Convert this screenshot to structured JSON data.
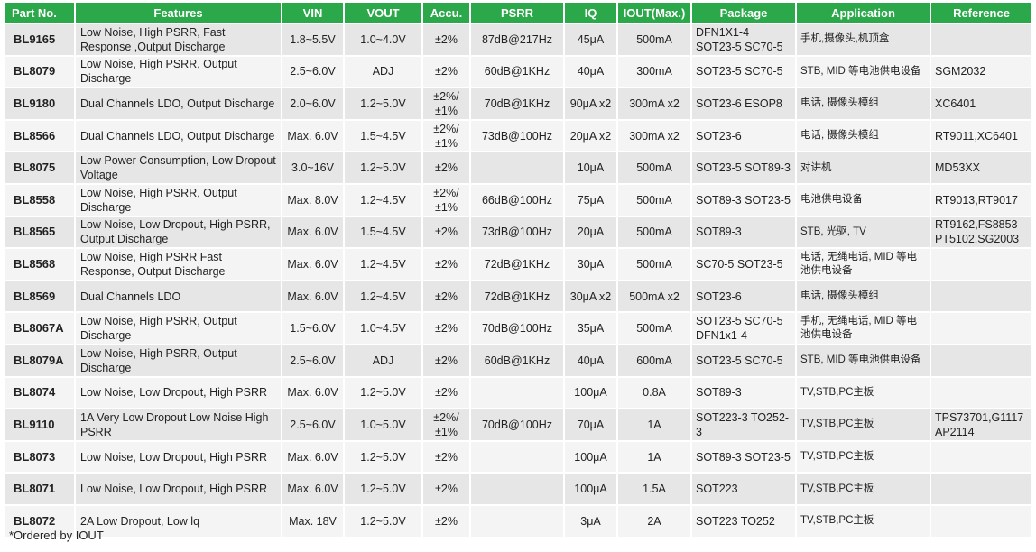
{
  "columns": [
    "Part No.",
    "Features",
    "VIN",
    "VOUT",
    "Accu.",
    "PSRR",
    "IQ",
    "IOUT(Max.)",
    "Package",
    "Application",
    "Reference"
  ],
  "rows": [
    {
      "part": "BL9165",
      "features": "Low Noise, High PSRR, Fast Response ,Output Discharge",
      "vin": "1.8~5.5V",
      "vout": "1.0~4.0V",
      "accu": "±2%",
      "psrr": "87dB@217Hz",
      "iq": "45μA",
      "iout": "500mA",
      "package": "DFN1X1-4 SOT23-5 SC70-5",
      "application": "手机,摄像头,机顶盒",
      "reference": ""
    },
    {
      "part": "BL8079",
      "features": "Low Noise, High PSRR, Output Discharge",
      "vin": "2.5~6.0V",
      "vout": "ADJ",
      "accu": "±2%",
      "psrr": "60dB@1KHz",
      "iq": "40μA",
      "iout": "300mA",
      "package": "SOT23-5 SC70-5",
      "application": "STB, MID 等电池供电设备",
      "reference": "SGM2032"
    },
    {
      "part": "BL9180",
      "features": "Dual Channels LDO, Output Discharge",
      "vin": "2.0~6.0V",
      "vout": "1.2~5.0V",
      "accu": "±2%/ ±1%",
      "psrr": "70dB@1KHz",
      "iq": "90μA x2",
      "iout": "300mA x2",
      "package": "SOT23-6 ESOP8",
      "application": "电话, 摄像头模组",
      "reference": "XC6401"
    },
    {
      "part": "BL8566",
      "features": "Dual Channels LDO, Output Discharge",
      "vin": "Max. 6.0V",
      "vout": "1.5~4.5V",
      "accu": "±2%/ ±1%",
      "psrr": "73dB@100Hz",
      "iq": "20μA x2",
      "iout": "300mA x2",
      "package": "SOT23-6",
      "application": "电话, 摄像头模组",
      "reference": "RT9011,XC6401"
    },
    {
      "part": "BL8075",
      "features": "Low Power Consumption, Low Dropout Voltage",
      "vin": "3.0~16V",
      "vout": "1.2~5.0V",
      "accu": "±2%",
      "psrr": "",
      "iq": "10μA",
      "iout": "500mA",
      "package": "SOT23-5 SOT89-3",
      "application": "对讲机",
      "reference": "MD53XX"
    },
    {
      "part": "BL8558",
      "features": "Low Noise, High PSRR, Output Discharge",
      "vin": "Max. 8.0V",
      "vout": "1.2~4.5V",
      "accu": "±2%/ ±1%",
      "psrr": "66dB@100Hz",
      "iq": "75μA",
      "iout": "500mA",
      "package": "SOT89-3 SOT23-5",
      "application": "电池供电设备",
      "reference": "RT9013,RT9017"
    },
    {
      "part": "BL8565",
      "features": "Low Noise, Low Dropout, High PSRR, Output Discharge",
      "vin": "Max. 6.0V",
      "vout": "1.5~4.5V",
      "accu": "±2%",
      "psrr": "73dB@100Hz",
      "iq": "20μA",
      "iout": "500mA",
      "package": "SOT89-3",
      "application": "STB, 光驱, TV",
      "reference": "RT9162,FS8853 PT5102,SG2003"
    },
    {
      "part": "BL8568",
      "features": "Low Noise, High PSRR Fast Response, Output Discharge",
      "vin": "Max. 6.0V",
      "vout": "1.2~4.5V",
      "accu": "±2%",
      "psrr": "72dB@1KHz",
      "iq": "30μA",
      "iout": "500mA",
      "package": "SC70-5 SOT23-5",
      "application": "电话, 无绳电话, MID 等电池供电设备",
      "reference": ""
    },
    {
      "part": "BL8569",
      "features": "Dual Channels LDO",
      "vin": "Max. 6.0V",
      "vout": "1.2~4.5V",
      "accu": "±2%",
      "psrr": "72dB@1KHz",
      "iq": "30μA x2",
      "iout": "500mA x2",
      "package": "SOT23-6",
      "application": "电话, 摄像头模组",
      "reference": ""
    },
    {
      "part": "BL8067A",
      "features": "Low Noise, High PSRR, Output Discharge",
      "vin": "1.5~6.0V",
      "vout": "1.0~4.5V",
      "accu": "±2%",
      "psrr": "70dB@100Hz",
      "iq": "35μA",
      "iout": "500mA",
      "package": "SOT23-5 SC70-5 DFN1x1-4",
      "application": "手机, 无绳电话, MID 等电池供电设备",
      "reference": ""
    },
    {
      "part": "BL8079A",
      "features": "Low Noise, High PSRR, Output Discharge",
      "vin": "2.5~6.0V",
      "vout": "ADJ",
      "accu": "±2%",
      "psrr": "60dB@1KHz",
      "iq": "40μA",
      "iout": "600mA",
      "package": "SOT23-5 SC70-5",
      "application": "STB, MID 等电池供电设备",
      "reference": ""
    },
    {
      "part": "BL8074",
      "features": "Low Noise, Low Dropout, High PSRR",
      "vin": "Max. 6.0V",
      "vout": "1.2~5.0V",
      "accu": "±2%",
      "psrr": "",
      "iq": "100μA",
      "iout": "0.8A",
      "package": "SOT89-3",
      "application": "TV,STB,PC主板",
      "reference": ""
    },
    {
      "part": "BL9110",
      "features": "1A Very Low Dropout Low Noise High PSRR",
      "vin": "2.5~6.0V",
      "vout": "1.0~5.0V",
      "accu": "±2%/ ±1%",
      "psrr": "70dB@100Hz",
      "iq": "70μA",
      "iout": "1A",
      "package": "SOT223-3 TO252-3",
      "application": "TV,STB,PC主板",
      "reference": "TPS73701,G1117 AP2114"
    },
    {
      "part": "BL8073",
      "features": "Low Noise, Low Dropout, High PSRR",
      "vin": "Max. 6.0V",
      "vout": "1.2~5.0V",
      "accu": "±2%",
      "psrr": "",
      "iq": "100μA",
      "iout": "1A",
      "package": "SOT89-3 SOT23-5",
      "application": "TV,STB,PC主板",
      "reference": ""
    },
    {
      "part": "BL8071",
      "features": "Low Noise, Low Dropout, High PSRR",
      "vin": "Max. 6.0V",
      "vout": "1.2~5.0V",
      "accu": "±2%",
      "psrr": "",
      "iq": "100μA",
      "iout": "1.5A",
      "package": "SOT223",
      "application": "TV,STB,PC主板",
      "reference": ""
    },
    {
      "part": "BL8072",
      "features": "2A Low Dropout, Low lq",
      "vin": "Max. 18V",
      "vout": "1.2~5.0V",
      "accu": "±2%",
      "psrr": "",
      "iq": "3μA",
      "iout": "2A",
      "package": "SOT223 TO252",
      "application": "TV,STB,PC主板",
      "reference": ""
    }
  ],
  "footnote": "*Ordered by IOUT",
  "colors": {
    "header_bg": "#2aa84a",
    "header_text": "#ffffff",
    "row_odd": "#e6e6e6",
    "row_even": "#f4f4f4"
  }
}
